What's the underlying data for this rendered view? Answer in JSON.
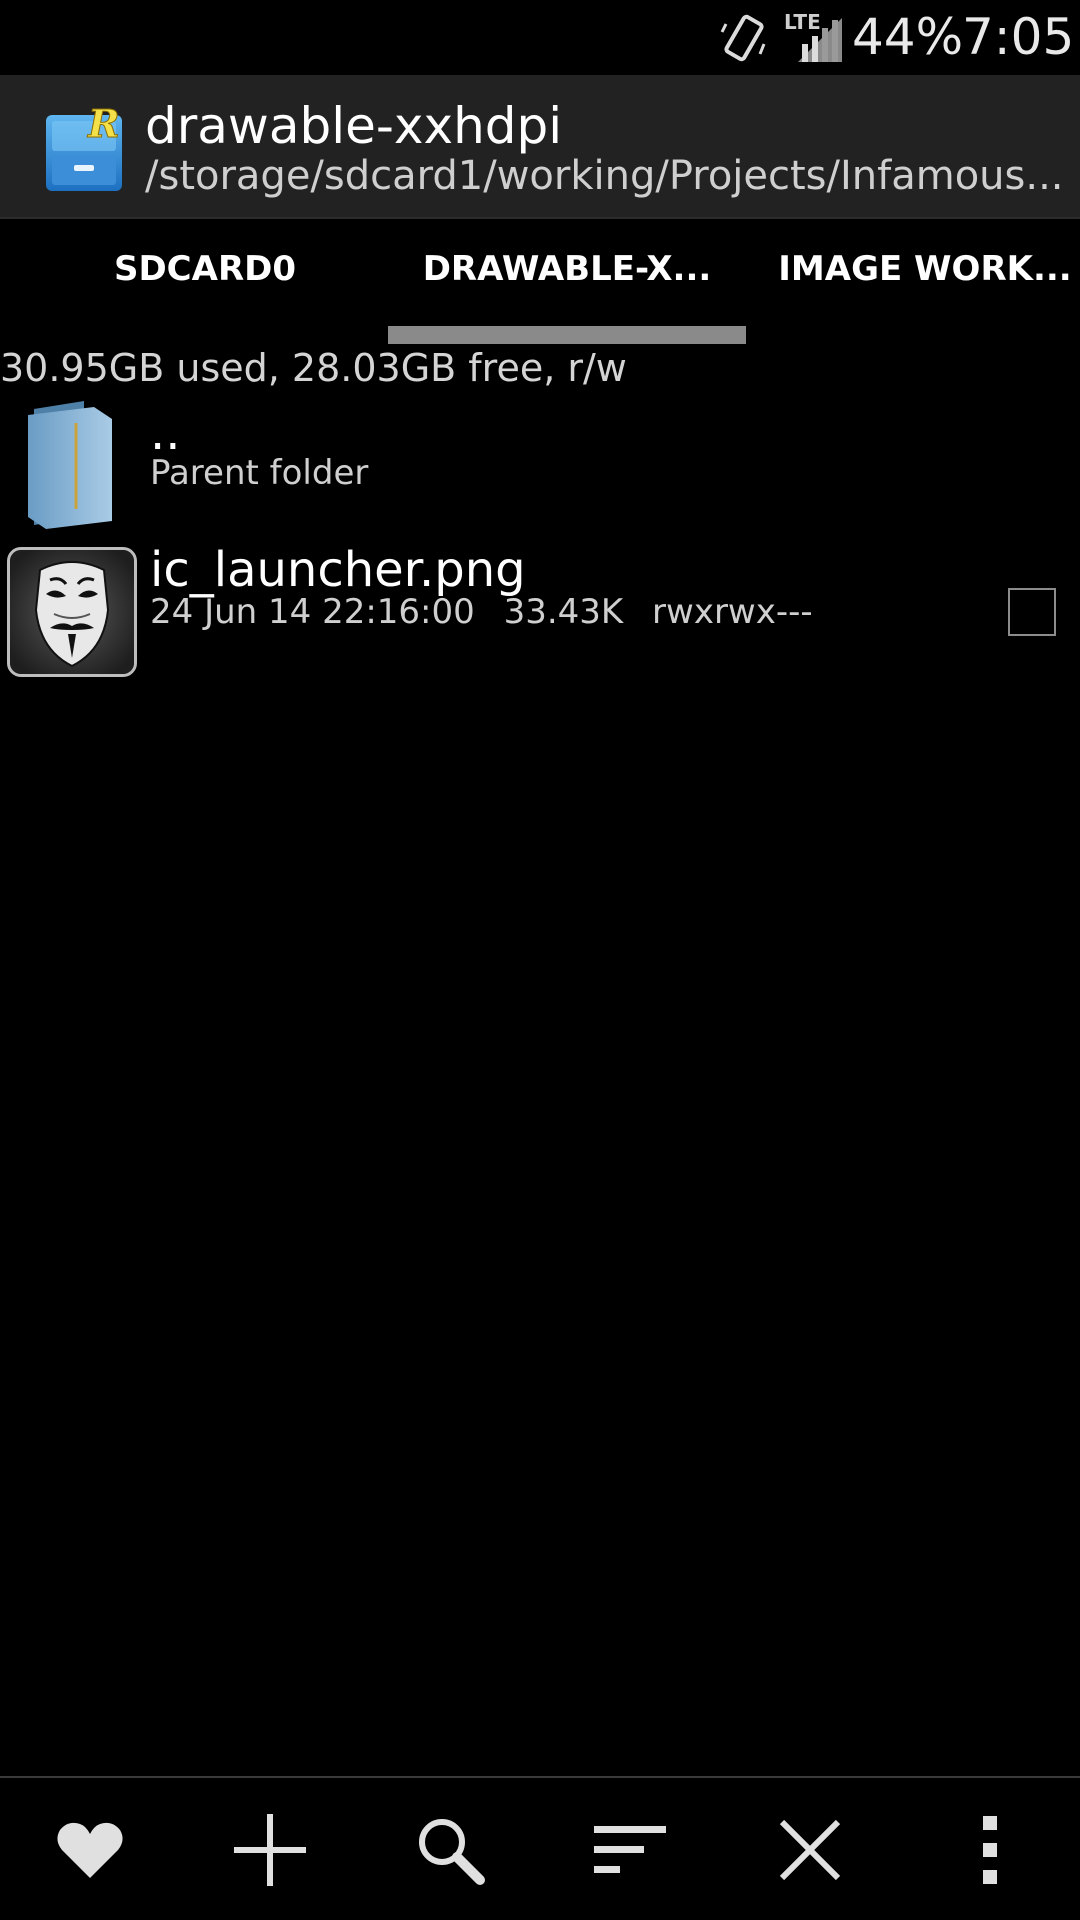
{
  "status_bar": {
    "network_label": "LTE",
    "battery": "44%",
    "time": "7:05"
  },
  "header": {
    "title": "drawable-xxhdpi",
    "path": "/storage/sdcard1/working/Projects/Infamous..."
  },
  "tabs": [
    {
      "label": "SDCARD0"
    },
    {
      "label": "DRAWABLE-X..."
    },
    {
      "label": "IMAGE WORK..."
    }
  ],
  "storage_info": "30.95GB used, 28.03GB free, r/w",
  "files": {
    "parent": {
      "name": "..",
      "subtitle": "Parent folder"
    },
    "items": [
      {
        "name": "ic_launcher.png",
        "date": "24 Jun 14 22:16:00",
        "size": "33.43K",
        "permissions": "rwxrwx---"
      }
    ]
  },
  "bottom_bar": {
    "buttons": [
      "heart-icon",
      "plus-icon",
      "search-icon",
      "sort-icon",
      "close-icon",
      "overflow-menu-icon"
    ]
  }
}
